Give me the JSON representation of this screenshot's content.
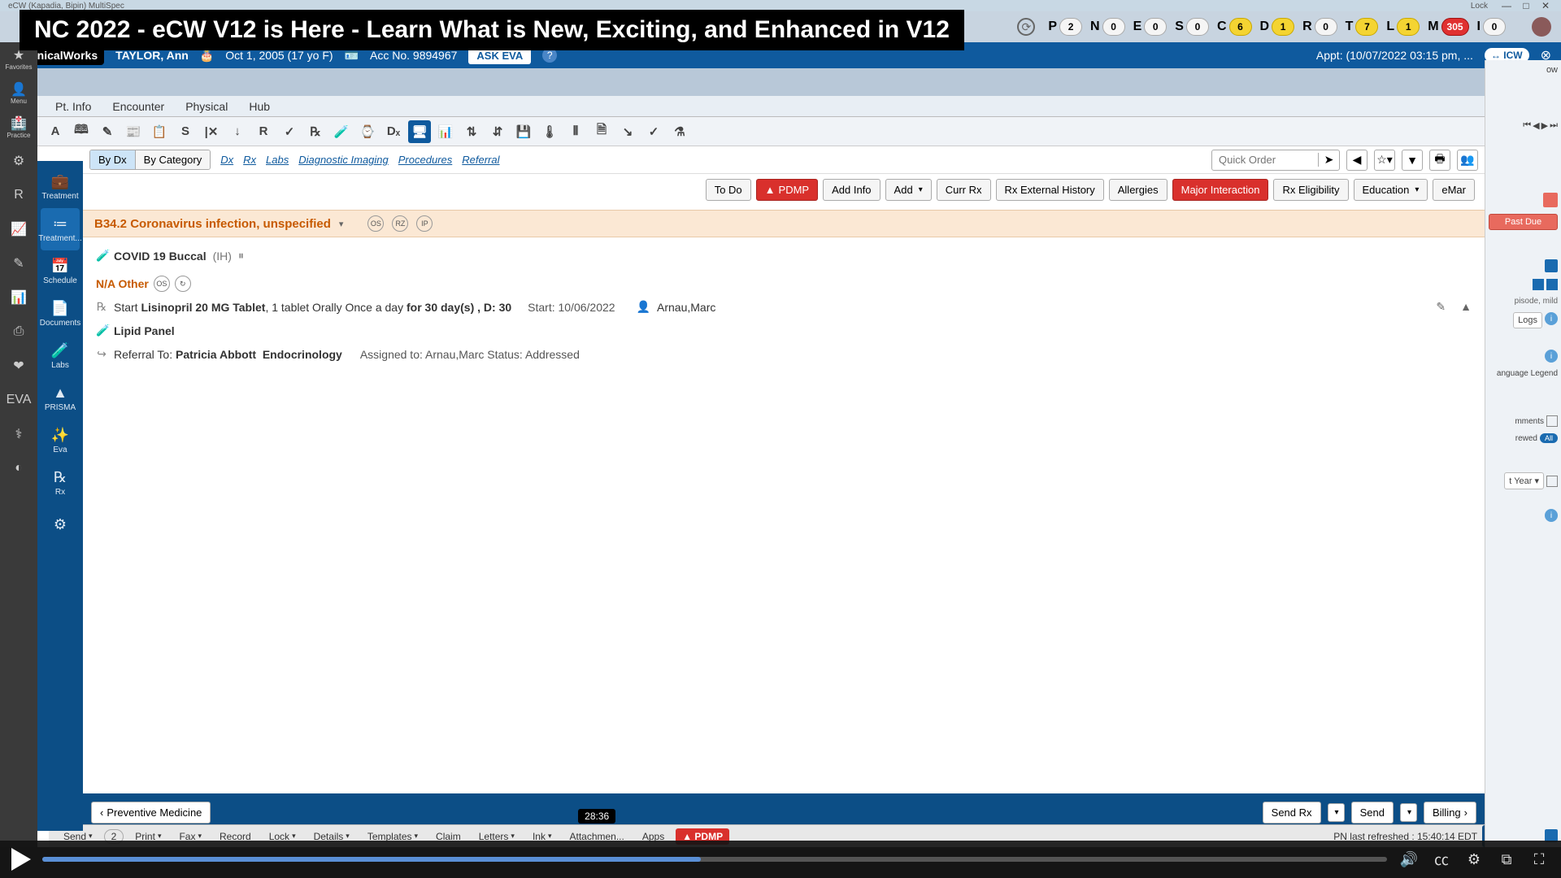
{
  "window": {
    "title_left": "eCW (Kapadia, Bipin) MultiSpec",
    "lock": "Lock",
    "minimize": "—",
    "maximize": "□",
    "close": "✕"
  },
  "banner": "NC 2022 - eCW V12 is Here - Learn What is New, Exciting, and Enhanced in V12",
  "beans": [
    {
      "letter": "P",
      "count": "2",
      "cls": "white"
    },
    {
      "letter": "N",
      "count": "0",
      "cls": "white"
    },
    {
      "letter": "E",
      "count": "0",
      "cls": "white"
    },
    {
      "letter": "S",
      "count": "0",
      "cls": "white"
    },
    {
      "letter": "C",
      "count": "6",
      "cls": "yellow"
    },
    {
      "letter": "D",
      "count": "1",
      "cls": "yellow"
    },
    {
      "letter": "R",
      "count": "0",
      "cls": "white"
    },
    {
      "letter": "T",
      "count": "7",
      "cls": "yellow"
    },
    {
      "letter": "L",
      "count": "1",
      "cls": "yellow"
    },
    {
      "letter": "M",
      "count": "305",
      "cls": "red"
    },
    {
      "letter": "I",
      "count": "0",
      "cls": "white"
    }
  ],
  "patient": {
    "logo": "eClinicalWorks",
    "name": "TAYLOR, Ann",
    "dob": "Oct 1, 2005 (17 yo F)",
    "acc": "Acc No. 9894967",
    "ask": "ASK EVA",
    "help": "?",
    "appt": "Appt: (10/07/2022 03:15 pm, ...",
    "icw": "↔ ICW"
  },
  "tabs": [
    "Pt. Info",
    "Encounter",
    "Physical",
    "Hub"
  ],
  "iconbar": [
    "A",
    "🕮",
    "✎",
    "📰",
    "📋",
    "S",
    "|✕",
    "↓",
    "R",
    "✓",
    "℞",
    "🧪",
    "⌚",
    "Dₓ",
    "🖥",
    "📊",
    "⇅",
    "⇵",
    "💾",
    "🌡",
    "⫴",
    "🗎",
    "↘",
    "✓",
    "⚗"
  ],
  "filter": {
    "seg1": [
      "By Dx",
      "By Category"
    ],
    "links": [
      "Dx",
      "Rx",
      "Labs",
      "Diagnostic Imaging",
      "Procedures",
      "Referral"
    ],
    "quick_ph": "Quick Order"
  },
  "actions": {
    "todo": "To Do",
    "pdmp": "PDMP",
    "addinfo": "Add Info",
    "add": "Add",
    "currrx": "Curr Rx",
    "rxext": "Rx External History",
    "allergies": "Allergies",
    "major": "Major Interaction",
    "rxelig": "Rx Eligibility",
    "edu": "Education",
    "emar": "eMar"
  },
  "outer_rail": [
    {
      "g": "★",
      "l": "Favorites"
    },
    {
      "g": "👤",
      "l": "Menu"
    },
    {
      "g": "🏥",
      "l": "Practice"
    },
    {
      "g": "⚙",
      "l": ""
    },
    {
      "g": "R",
      "l": ""
    },
    {
      "g": "📈",
      "l": ""
    },
    {
      "g": "✎",
      "l": ""
    },
    {
      "g": "📊",
      "l": ""
    },
    {
      "g": "⎙",
      "l": ""
    },
    {
      "g": "❤",
      "l": ""
    },
    {
      "g": "EVA",
      "l": ""
    },
    {
      "g": "⚕",
      "l": ""
    },
    {
      "g": "◐",
      "l": ""
    }
  ],
  "inner_rail": [
    {
      "g": "💼",
      "l": "Treatment",
      "active": false
    },
    {
      "g": "≔",
      "l": "Treatment...",
      "active": true
    },
    {
      "g": "📅",
      "l": "Schedule",
      "active": false
    },
    {
      "g": "📄",
      "l": "Documents",
      "active": false
    },
    {
      "g": "🧪",
      "l": "Labs",
      "active": false
    },
    {
      "g": "▲",
      "l": "PRISMA",
      "active": false
    },
    {
      "g": "✨",
      "l": "Eva",
      "active": false
    },
    {
      "g": "℞",
      "l": "Rx",
      "active": false
    },
    {
      "g": "⚙",
      "l": "",
      "active": false
    }
  ],
  "clinical": {
    "dx_code": "B34.2 Coronavirus infection, unspecified",
    "dx_rings": [
      "OS",
      "RZ",
      "IP"
    ],
    "covid_label": "COVID 19 Buccal",
    "covid_ih": "(IH)",
    "other_head": "N/A Other",
    "other_rings": [
      "OS",
      "↻"
    ],
    "rx_pre": "Start ",
    "rx_name": "Lisinopril 20 MG Tablet",
    "rx_mid": ", 1 tablet Orally Once a day ",
    "rx_bold": "for 30 day(s) , D: 30",
    "rx_start": "Start: 10/06/2022",
    "rx_prov": "Arnau,Marc",
    "lipid": "Lipid Panel",
    "ref_pre": "Referral To: ",
    "ref_name": "Patricia Abbott",
    "ref_spec": "Endocrinology",
    "ref_assigned": "Assigned to: Arnau,Marc Status: Addressed"
  },
  "content_footer": {
    "prev": "Preventive Medicine",
    "sendrx": "Send Rx",
    "send": "Send",
    "billing": "Billing"
  },
  "lower": {
    "items": [
      "Send",
      "2",
      "Print",
      "Fax",
      "Record",
      "Lock",
      "Details",
      "Templates",
      "Claim",
      "Letters",
      "Ink",
      "Attachmen...",
      "Apps"
    ],
    "pdmp": "▲ PDMP",
    "pn": "PN last refreshed : 15:40:14 EDT",
    "bubble": "28:36"
  },
  "right_peek": {
    "now": "ow",
    "pastdue": "Past Due",
    "logs": "Logs",
    "legend": "anguage Legend",
    "mments": "mments",
    "rewed": "rewed",
    "all": "All",
    "year": "t Year ▾"
  },
  "player": {
    "progress_pct": 49
  }
}
